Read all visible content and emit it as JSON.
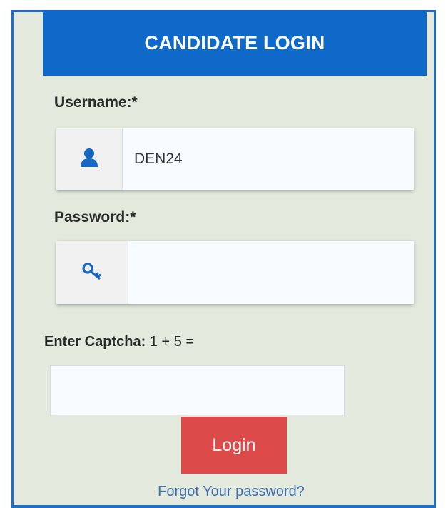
{
  "header": {
    "title": "CANDIDATE LOGIN"
  },
  "username": {
    "label": "Username:*",
    "value": "DEN24",
    "icon": "user-icon"
  },
  "password": {
    "label": "Password:*",
    "value": "",
    "icon": "key-icon"
  },
  "captcha": {
    "label": "Enter Captcha:",
    "question": "1 + 5 =",
    "value": ""
  },
  "login_button": {
    "label": "Login"
  },
  "forgot_link": {
    "label": "Forgot Your password?"
  },
  "colors": {
    "header_bg": "#0e69c8",
    "panel_bg": "#e3e9dc",
    "login_bg": "#dc4a4a",
    "link": "#3f6fae",
    "icon_blue": "#1666c5"
  }
}
